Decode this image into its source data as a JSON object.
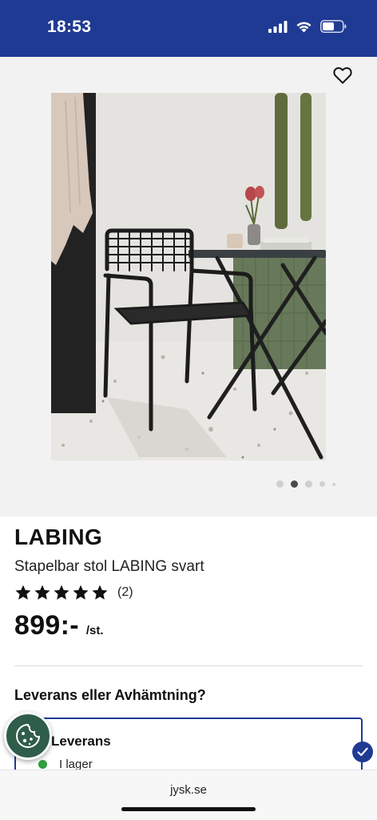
{
  "status_bar": {
    "time": "18:53",
    "icons": [
      "signal-icon",
      "wifi-icon",
      "battery-icon"
    ]
  },
  "gallery": {
    "favorite_icon": "heart-icon",
    "image": "outdoor-black-chair-photo",
    "dots_count": 5,
    "active_dot": 2
  },
  "product": {
    "brand": "LABING",
    "subtitle": "Stapelbar stol LABING svart",
    "rating": 5,
    "rating_count": "(2)",
    "price": "899:-",
    "price_unit": "/st."
  },
  "delivery": {
    "title": "Leverans eller Avhämtning?",
    "option_label": "Leverans",
    "stock_label": "I lager"
  },
  "browser": {
    "url": "jysk.se"
  },
  "colors": {
    "brand_blue": "#1f3a93",
    "stock_green": "#2e9e3e",
    "cookie_green": "#2f5d49"
  }
}
